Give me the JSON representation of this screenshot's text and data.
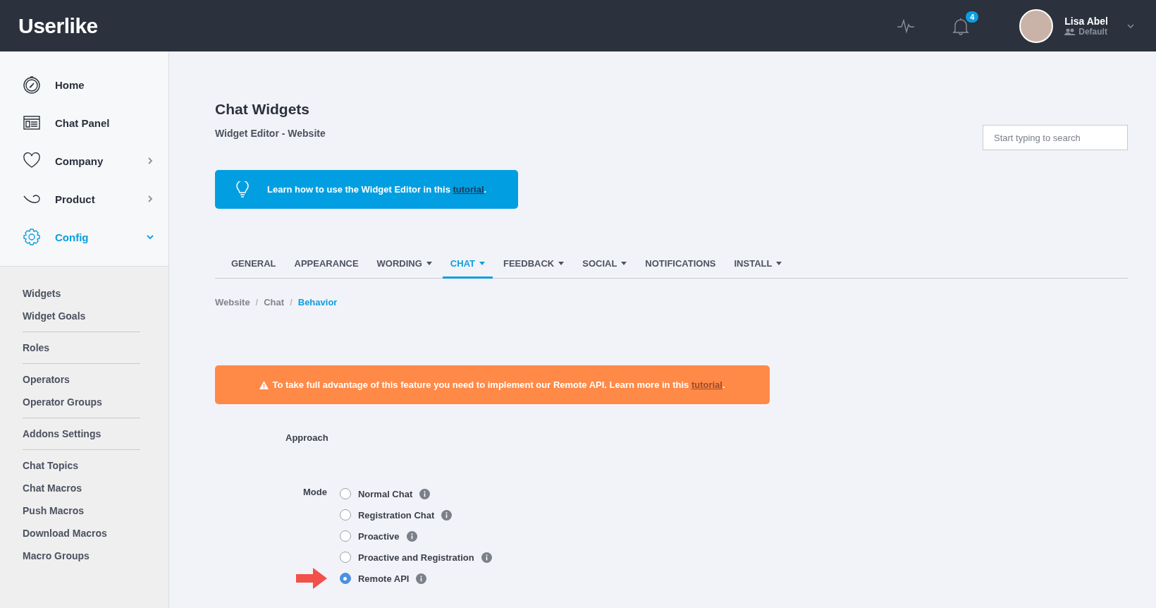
{
  "header": {
    "logo": "Userlike",
    "notification_count": "4",
    "user": {
      "name": "Lisa Abel",
      "role": "Default"
    }
  },
  "sidebar": {
    "nav_items": [
      {
        "label": "Home",
        "kind": "link",
        "selected": false
      },
      {
        "label": "Chat Panel",
        "kind": "link",
        "selected": false
      },
      {
        "label": "Company",
        "kind": "menu",
        "selected": false,
        "expanded": false
      },
      {
        "label": "Product",
        "kind": "menu",
        "selected": false,
        "expanded": false
      },
      {
        "label": "Config",
        "kind": "menu",
        "selected": true,
        "expanded": true
      }
    ],
    "sub_groups": [
      {
        "items": [
          "Widgets",
          "Widget Goals"
        ]
      },
      {
        "items": [
          "Roles"
        ]
      },
      {
        "items": [
          "Operators",
          "Operator Groups"
        ]
      },
      {
        "items": [
          "Addons Settings"
        ]
      },
      {
        "items": [
          "Chat Topics",
          "Chat Macros",
          "Push Macros",
          "Download Macros",
          "Macro Groups"
        ]
      }
    ]
  },
  "page": {
    "title": "Chat Widgets",
    "subtitle": "Widget Editor - Website",
    "search": {
      "placeholder": "Start typing to search"
    },
    "tip": {
      "text": "Learn how to use the Widget Editor in this",
      "link": "tutorial",
      "after": "."
    },
    "tabs": [
      {
        "label": "GENERAL",
        "dropdown": false,
        "selected": false
      },
      {
        "label": "APPEARANCE",
        "dropdown": false,
        "selected": false
      },
      {
        "label": "WORDING",
        "dropdown": true,
        "selected": false
      },
      {
        "label": "CHAT",
        "dropdown": true,
        "selected": true
      },
      {
        "label": "FEEDBACK",
        "dropdown": true,
        "selected": false
      },
      {
        "label": "SOCIAL",
        "dropdown": true,
        "selected": false
      },
      {
        "label": "NOTIFICATIONS",
        "dropdown": false,
        "selected": false
      },
      {
        "label": "INSTALL",
        "dropdown": true,
        "selected": false
      }
    ],
    "breadcrumb": [
      {
        "label": "Website",
        "selected": false
      },
      {
        "separator": "/",
        "label": "Chat",
        "selected": false
      },
      {
        "separator": "/",
        "label": "Behavior",
        "selected": true
      }
    ],
    "warning": {
      "text": "To take full advantage of this feature you need to implement our Remote API. Learn more in this",
      "link": "tutorial",
      "after": "."
    },
    "section_label": "Approach",
    "mode": {
      "label": "Mode",
      "options": [
        {
          "label": "Normal Chat",
          "selected": false,
          "pointer": false
        },
        {
          "label": "Registration Chat",
          "selected": false,
          "pointer": false
        },
        {
          "label": "Proactive",
          "selected": false,
          "pointer": false
        },
        {
          "label": "Proactive and Registration",
          "selected": false,
          "pointer": false
        },
        {
          "label": "Remote API",
          "selected": true,
          "pointer": true
        }
      ]
    }
  }
}
